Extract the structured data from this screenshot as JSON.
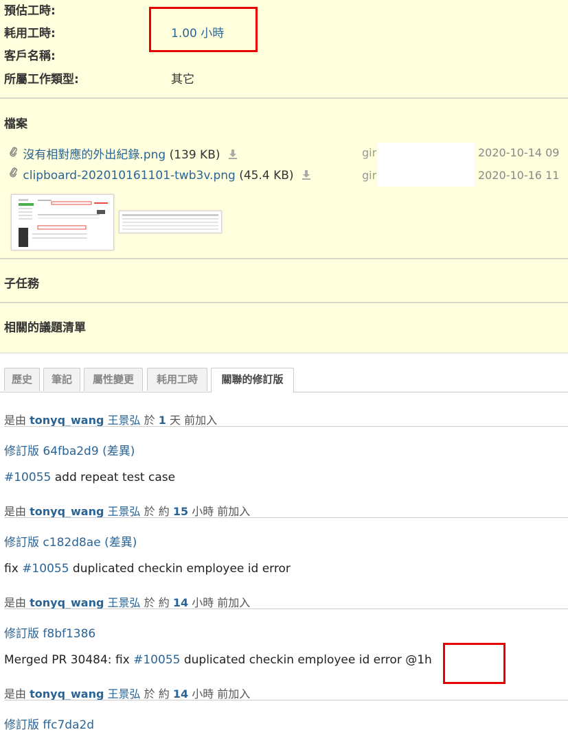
{
  "attributes": [
    {
      "label": "預估工時:",
      "value": ""
    },
    {
      "label": "耗用工時:",
      "value": "1.00 小時"
    },
    {
      "label": "客戶名稱:",
      "value": ""
    },
    {
      "label": "所屬工作類型:",
      "value": "其它"
    }
  ],
  "files": {
    "title": "檔案",
    "items": [
      {
        "name": "沒有相對應的外出紀錄.png",
        "size": "(139 KB)",
        "author": "gir",
        "date": "2020-10-14 09"
      },
      {
        "name": "clipboard-202010161101-twb3v.png",
        "size": "(45.4 KB)",
        "author": "gir",
        "date": "2020-10-16 11"
      }
    ]
  },
  "subtasks_title": "子任務",
  "related_title": "相關的議題清單",
  "tabs": [
    "歷史",
    "筆記",
    "屬性變更",
    "耗用工時",
    "關聯的修訂版"
  ],
  "journal": [
    {
      "prefix": "是由",
      "user": "tonyq_wang",
      "name": "王景弘",
      "mid": "於",
      "ago": "1",
      "suffix": "天 前加入",
      "rev_label": "修訂版",
      "rev_id": "64fba2d9",
      "diff": "(差異)",
      "msg_pre": "",
      "issue": "#10055",
      "msg_post": " add repeat test case"
    },
    {
      "prefix": "是由",
      "user": "tonyq_wang",
      "name": "王景弘",
      "mid": "於 約",
      "ago": "15",
      "suffix": "小時 前加入",
      "rev_label": "修訂版",
      "rev_id": "c182d8ae",
      "diff": "(差異)",
      "msg_pre": "fix ",
      "issue": "#10055",
      "msg_post": " duplicated checkin employee id error"
    },
    {
      "prefix": "是由",
      "user": "tonyq_wang",
      "name": "王景弘",
      "mid": "於 約",
      "ago": "14",
      "suffix": "小時 前加入",
      "rev_label": "修訂版",
      "rev_id": "f8bf1386",
      "diff": "",
      "msg_pre": "Merged PR 30484: fix ",
      "issue": "#10055",
      "msg_post": " duplicated checkin employee id error @1h"
    },
    {
      "prefix": "是由",
      "user": "tonyq_wang",
      "name": "王景弘",
      "mid": "於 約",
      "ago": "14",
      "suffix": "小時 前加入",
      "rev_label": "修訂版",
      "rev_id": "ffc7da2d",
      "diff": "",
      "msg_pre": "",
      "issue": "",
      "msg_post": ""
    }
  ],
  "colors": {
    "panel_bg": "#ffffdd",
    "link": "#2a6496",
    "highlight": "#e60000"
  }
}
